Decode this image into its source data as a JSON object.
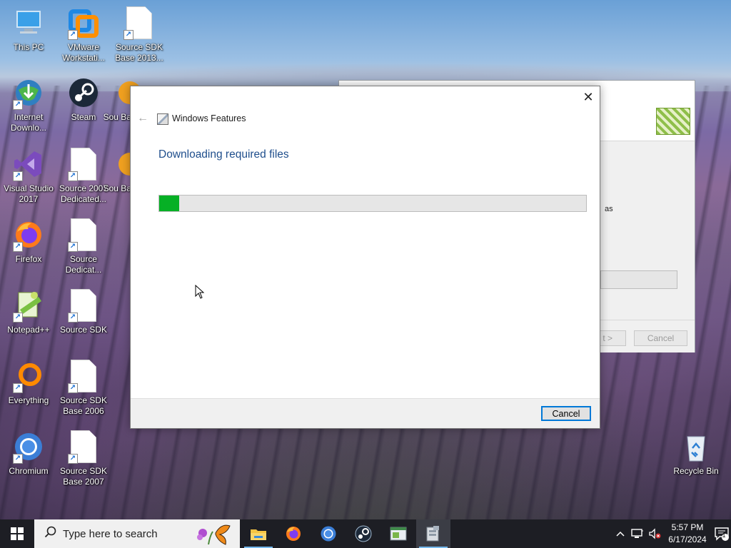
{
  "desktop": {
    "icons": [
      {
        "label": "This PC"
      },
      {
        "label": "VMware Workstati..."
      },
      {
        "label": "Source SDK Base 2013..."
      },
      {
        "label": "Internet Downlo..."
      },
      {
        "label": "Steam"
      },
      {
        "label": "Sou Bas"
      },
      {
        "label": "Visual Studio 2017"
      },
      {
        "label": "Source 2007 Dedicated..."
      },
      {
        "label": "Sou Bas"
      },
      {
        "label": "Firefox"
      },
      {
        "label": "Source Dedicat..."
      },
      {
        "label": "Notepad++"
      },
      {
        "label": "Source SDK"
      },
      {
        "label": "Everything"
      },
      {
        "label": "Source SDK Base 2006"
      },
      {
        "label": "Chromium"
      },
      {
        "label": "Source SDK Base 2007"
      },
      {
        "label": "Recycle Bin"
      }
    ]
  },
  "background_window": {
    "text_fragment": "as",
    "next_label": "t >",
    "cancel_label": "Cancel"
  },
  "dialog": {
    "title": "Windows Features",
    "heading": "Downloading required files",
    "progress": 0.047,
    "progress_color": "#06b025",
    "cancel_label": "Cancel",
    "close_glyph": "✕",
    "back_glyph": "←"
  },
  "taskbar": {
    "search_placeholder": "Type here to search",
    "apps": [
      "file-explorer",
      "firefox",
      "chromium",
      "steam",
      "notepad-plus-plus",
      "windows-features"
    ],
    "clock_time": "5:57 PM",
    "clock_date": "6/17/2024",
    "notification_count": "1",
    "accent": "#76b9ed"
  }
}
